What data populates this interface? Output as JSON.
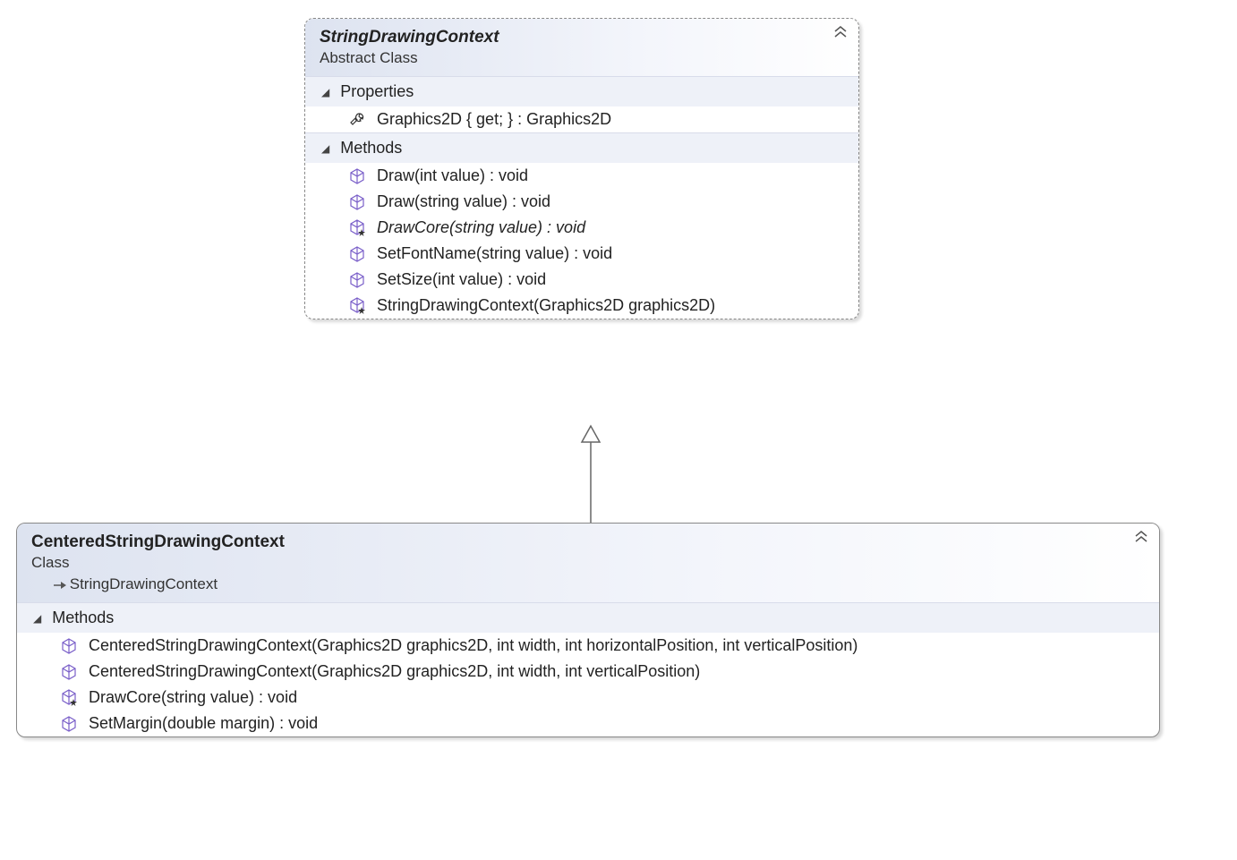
{
  "top_class": {
    "name": "StringDrawingContext",
    "stereotype": "Abstract Class",
    "is_abstract": true,
    "sections": [
      {
        "title": "Properties",
        "members": [
          {
            "icon": "wrench",
            "text": "Graphics2D { get; } : Graphics2D",
            "italic": false
          }
        ]
      },
      {
        "title": "Methods",
        "members": [
          {
            "icon": "cube",
            "text": "Draw(int value) : void",
            "italic": false
          },
          {
            "icon": "cube",
            "text": "Draw(string value) : void",
            "italic": false
          },
          {
            "icon": "cube-star",
            "text": "DrawCore(string value) : void",
            "italic": true
          },
          {
            "icon": "cube",
            "text": "SetFontName(string value) : void",
            "italic": false
          },
          {
            "icon": "cube",
            "text": "SetSize(int value) : void",
            "italic": false
          },
          {
            "icon": "cube-star",
            "text": "StringDrawingContext(Graphics2D graphics2D)",
            "italic": false
          }
        ]
      }
    ]
  },
  "bottom_class": {
    "name": "CenteredStringDrawingContext",
    "stereotype": "Class",
    "base": "StringDrawingContext",
    "is_abstract": false,
    "sections": [
      {
        "title": "Methods",
        "members": [
          {
            "icon": "cube",
            "text": "CenteredStringDrawingContext(Graphics2D graphics2D, int width, int horizontalPosition, int verticalPosition)",
            "italic": false
          },
          {
            "icon": "cube",
            "text": "CenteredStringDrawingContext(Graphics2D graphics2D, int width, int verticalPosition)",
            "italic": false
          },
          {
            "icon": "cube-star",
            "text": "DrawCore(string value) : void",
            "italic": false
          },
          {
            "icon": "cube",
            "text": "SetMargin(double margin) : void",
            "italic": false
          }
        ]
      }
    ]
  }
}
